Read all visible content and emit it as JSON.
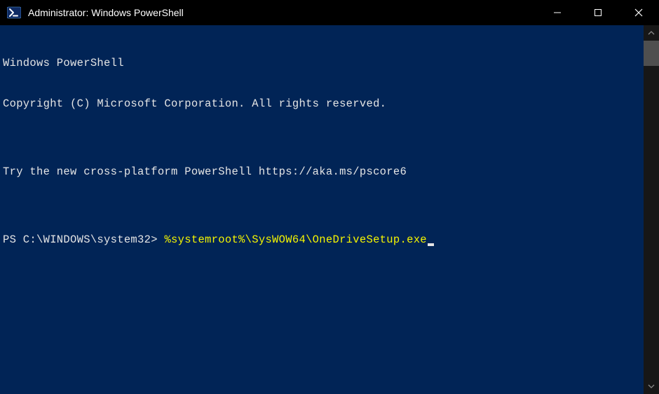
{
  "window": {
    "title": "Administrator: Windows PowerShell"
  },
  "terminal": {
    "lines": [
      "Windows PowerShell",
      "Copyright (C) Microsoft Corporation. All rights reserved.",
      "",
      "Try the new cross-platform PowerShell https://aka.ms/pscore6",
      ""
    ],
    "prompt": "PS C:\\WINDOWS\\system32> ",
    "command": "%systemroot%\\SysWOW64\\OneDriveSetup.exe"
  }
}
